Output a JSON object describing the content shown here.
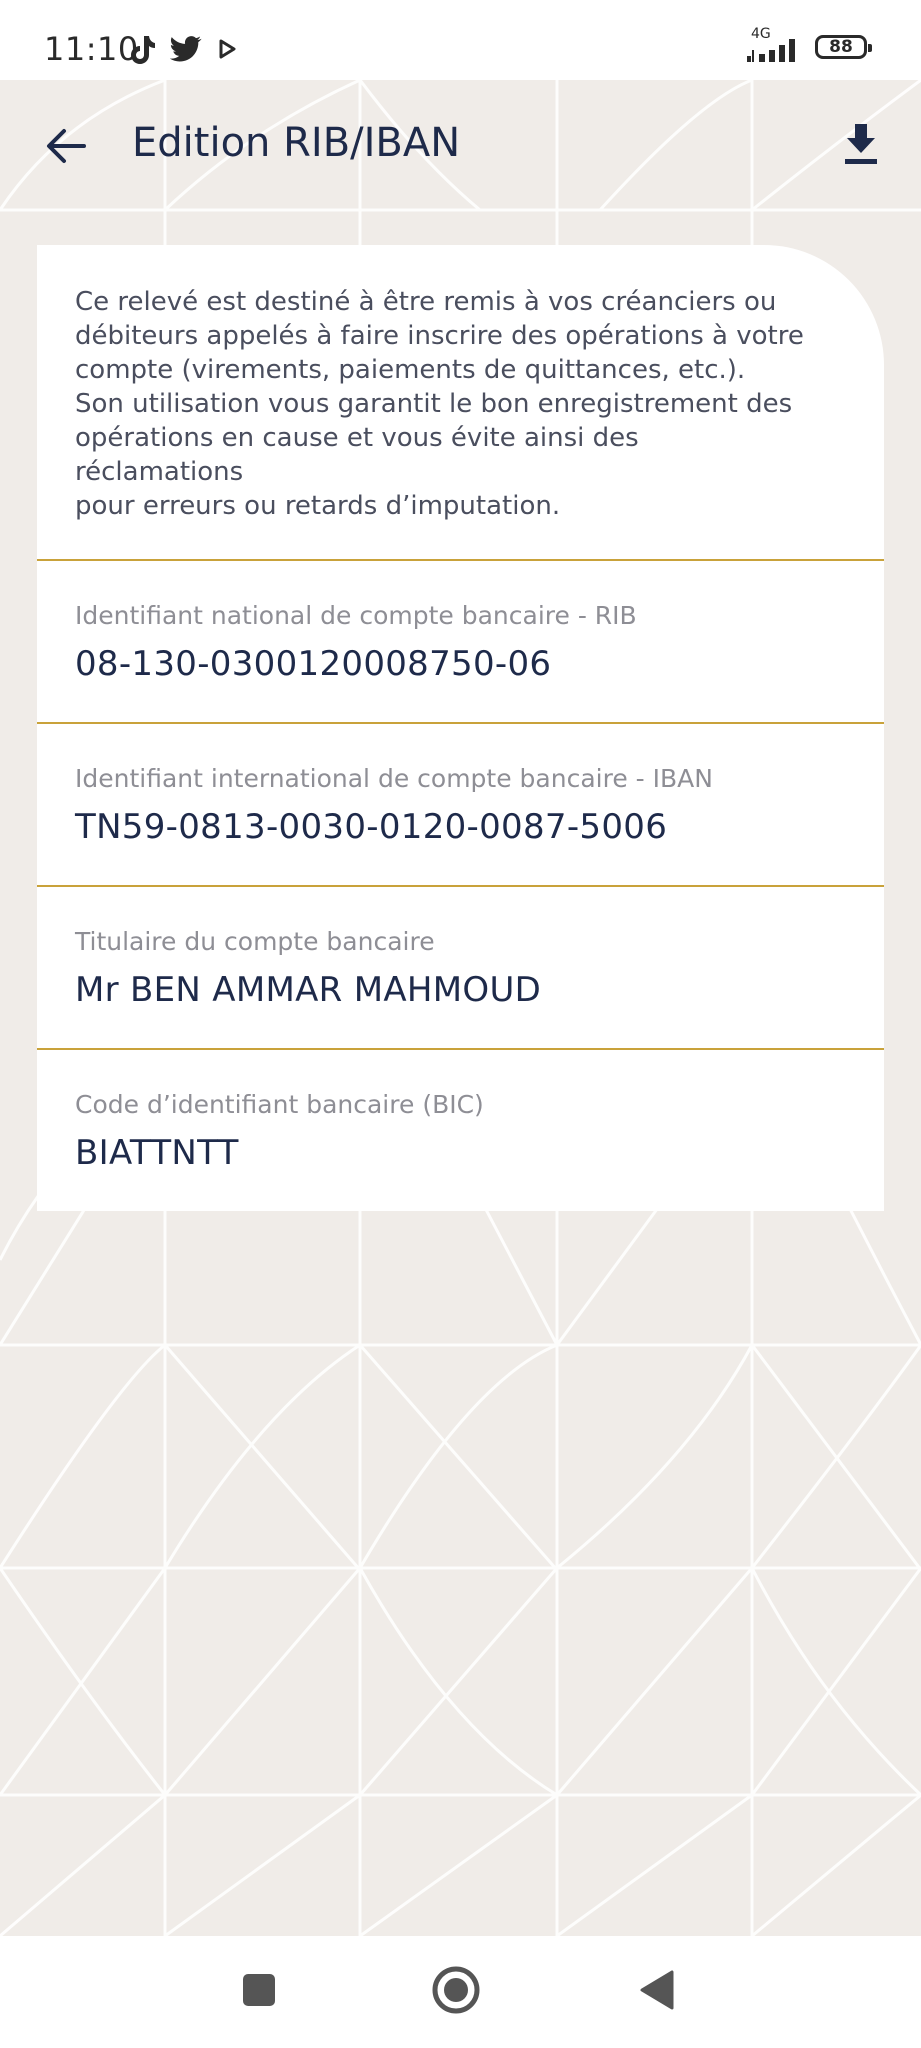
{
  "status_bar": {
    "time": "11:10",
    "network": "4G",
    "battery": "88",
    "icons": [
      "tiktok-icon",
      "twitter-icon",
      "play-icon",
      "signal-icon",
      "battery-icon"
    ]
  },
  "header": {
    "title": "Edition RIB/IBAN",
    "back_icon": "arrow-left-icon",
    "download_icon": "download-icon"
  },
  "card": {
    "intro": "Ce relevé est destiné à être remis à vos créanciers ou\ndébiteurs appelés à faire inscrire des opérations à votre\ncompte (virements, paiements de quittances, etc.).\nSon utilisation vous garantit le bon enregistrement des\nopérations en cause et vous évite ainsi des réclamations\npour erreurs ou retards d’imputation.",
    "fields": [
      {
        "label": "Identifiant national de compte bancaire - RIB",
        "value": "08-130-0300120008750-06"
      },
      {
        "label": "Identifiant international de compte bancaire - IBAN",
        "value": "TN59-0813-0030-0120-0087-5006"
      },
      {
        "label": "Titulaire du compte bancaire",
        "value": "Mr BEN AMMAR MAHMOUD"
      },
      {
        "label": "Code d’identifiant bancaire (BIC)",
        "value": "BIATTNTT"
      }
    ]
  },
  "nav_bar": {
    "icons": [
      "recents-square-icon",
      "home-circle-icon",
      "back-triangle-icon"
    ]
  },
  "colors": {
    "primary": "#1e2a4a",
    "accent_line": "#c9a23a",
    "background": "#f0ece8",
    "label_gray": "#8e8e95"
  }
}
